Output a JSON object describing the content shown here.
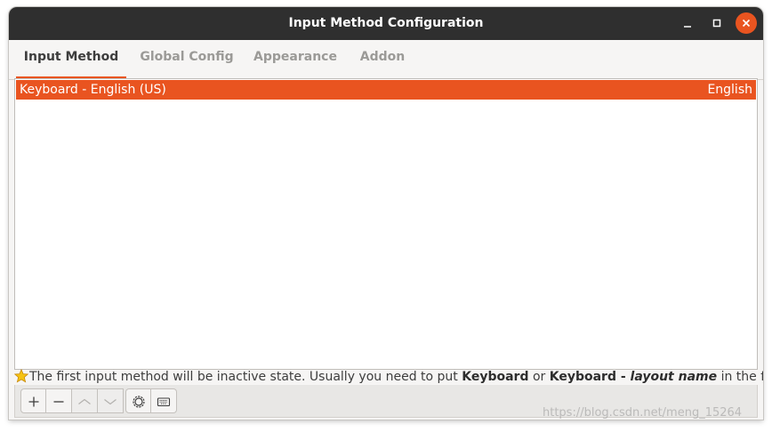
{
  "window": {
    "title": "Input Method Configuration",
    "controls": [
      "minimize-icon",
      "maximize-icon",
      "close-icon"
    ],
    "close_color": "#e95420"
  },
  "tabs": [
    {
      "label": "Input Method",
      "active": true
    },
    {
      "label": "Global Config",
      "active": false
    },
    {
      "label": "Appearance",
      "active": false
    },
    {
      "label": "Addon",
      "active": false
    }
  ],
  "input_methods": [
    {
      "name": "Keyboard - English (US)",
      "language": "English",
      "selected": true
    }
  ],
  "hint": {
    "icon": "star-icon",
    "prefix": "The first input method will be inactive state. Usually you need to put ",
    "bold1": "Keyboard",
    "mid": " or ",
    "bold2": "Keyboard - ",
    "bold_italic": "layout name",
    "suffix": " in the first place."
  },
  "toolbar": {
    "buttons": [
      "add-icon",
      "remove-icon",
      "move-up-icon",
      "move-down-icon",
      "configure-icon",
      "keyboard-layout-icon"
    ]
  },
  "watermark": "https://blog.csdn.net/meng_15264",
  "colors": {
    "accent": "#e95420",
    "titlebar": "#2f2f2f",
    "window_bg": "#f6f5f4"
  }
}
